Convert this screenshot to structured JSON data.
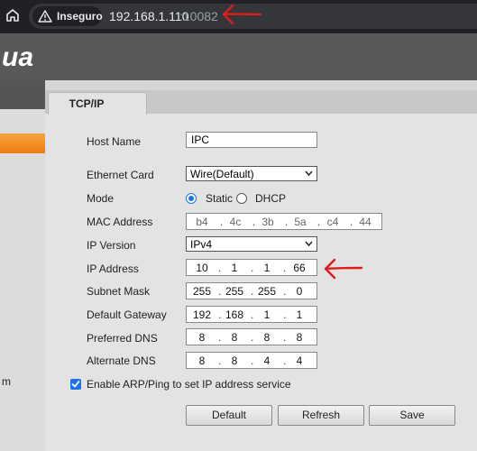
{
  "browser": {
    "security_label": "Inseguro",
    "url_host": "192.168.1.110",
    "url_port": ":10082"
  },
  "sidebar": {
    "partial_item": "m"
  },
  "tabs": [
    {
      "label": "TCP/IP"
    }
  ],
  "form": {
    "host_name": {
      "label": "Host Name",
      "value": "IPC"
    },
    "ethernet_card": {
      "label": "Ethernet Card",
      "value": "Wire(Default)"
    },
    "mode": {
      "label": "Mode",
      "options": [
        "Static",
        "DHCP"
      ],
      "selected": "Static"
    },
    "mac_address": {
      "label": "MAC Address",
      "octets": [
        "b4",
        "4c",
        "3b",
        "5a",
        "c4",
        "44"
      ]
    },
    "ip_version": {
      "label": "IP Version",
      "value": "IPv4"
    },
    "ip_address": {
      "label": "IP Address",
      "octets": [
        "10",
        "1",
        "1",
        "66"
      ]
    },
    "subnet_mask": {
      "label": "Subnet Mask",
      "octets": [
        "255",
        "255",
        "255",
        "0"
      ]
    },
    "default_gateway": {
      "label": "Default Gateway",
      "octets": [
        "192",
        "168",
        "1",
        "1"
      ]
    },
    "preferred_dns": {
      "label": "Preferred DNS",
      "octets": [
        "8",
        "8",
        "8",
        "8"
      ]
    },
    "alternate_dns": {
      "label": "Alternate DNS",
      "octets": [
        "8",
        "8",
        "4",
        "4"
      ]
    },
    "arp_ping": {
      "label": "Enable ARP/Ping to set IP address service",
      "checked": true
    }
  },
  "buttons": {
    "default": "Default",
    "refresh": "Refresh",
    "save": "Save"
  },
  "colors": {
    "annotation_red": "#e01b1b",
    "active_orange": "#f39325",
    "header_gray": "#595959"
  }
}
